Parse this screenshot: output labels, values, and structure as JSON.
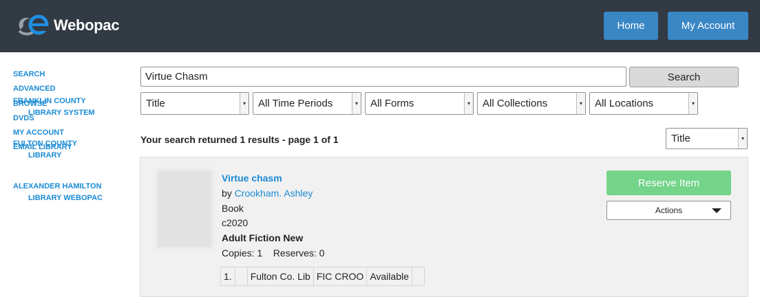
{
  "header": {
    "logo_icon": "webopac-logo-icon",
    "logo_text": "Webopac",
    "home_label": "Home",
    "account_label": "My Account"
  },
  "sidebar": {
    "links": [
      "SEARCH",
      "ADVANCED",
      "BROWSE",
      "DVDS",
      "MY ACCOUNT",
      "EMAIL LIBRARY"
    ],
    "libraries": [
      {
        "line1": "FRANKLIN COUNTY",
        "line2": "LIBRARY SYSTEM"
      },
      {
        "line1": "FULTON COUNTY",
        "line2": "LIBRARY"
      },
      {
        "line1": "ALEXANDER HAMILTON",
        "line2": "LIBRARY WEBOPAC"
      }
    ]
  },
  "search": {
    "query": "Virtue Chasm",
    "button_label": "Search",
    "filters": [
      "Title",
      "All Time Periods",
      "All Forms",
      "All Collections",
      "All Locations"
    ]
  },
  "results": {
    "summary": "Your search returned 1 results - page 1 of 1",
    "sort": "Title"
  },
  "item": {
    "title": "Virtue chasm",
    "by": "by ",
    "author": "Crookham. Ashley",
    "format": "Book",
    "date": "c2020",
    "shelf": "Adult Fiction New",
    "copies": "Copies: 1",
    "reserves": "Reserves: 0",
    "reserve_label": "Reserve Item",
    "actions_label": "Actions",
    "holdings": [
      [
        "1.",
        "",
        "Fulton Co. Lib",
        "FIC CROO",
        "Available",
        ""
      ]
    ]
  },
  "colors": {
    "header_bg": "#323a44",
    "button_blue": "#3a87c6",
    "link_blue": "#1a8ad4",
    "reserve_green": "#73d48a"
  }
}
